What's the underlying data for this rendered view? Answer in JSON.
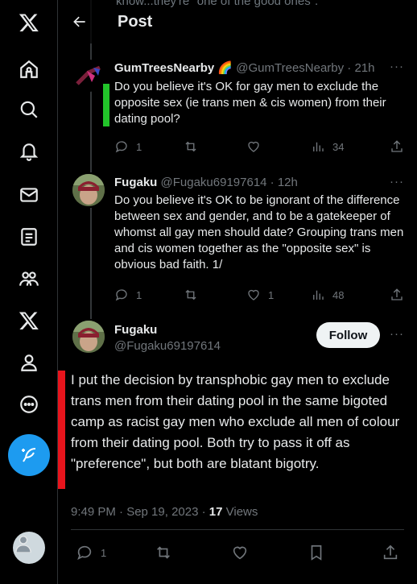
{
  "header": {
    "title": "Post",
    "ghost_text": "know...they're \"one of the good ones\"."
  },
  "nav": {
    "items": [
      "x-logo",
      "home",
      "explore",
      "notifications",
      "messages",
      "lists",
      "communities",
      "premium",
      "profile",
      "more"
    ],
    "post_button_icon": "compose-icon"
  },
  "tweets": [
    {
      "name": "GumTreesNearby",
      "handle": "@GumTreesNearby · 21h",
      "badge": "🌈",
      "text": "Do you believe it's OK for gay men to exclude the opposite sex (ie trans men & cis women) from their dating pool?",
      "replies": "1",
      "retweets": "",
      "likes": "",
      "views": "34"
    },
    {
      "name": "Fugaku",
      "handle": "@Fugaku69197614 · 12h",
      "text": "Do you believe it's OK to be ignorant of the difference between sex and gender, and to be a gatekeeper of whomst all gay men should date? Grouping trans men and cis women together as the \"opposite sex\" is obvious bad faith. 1/",
      "replies": "1",
      "retweets": "",
      "likes": "1",
      "views": "48"
    }
  ],
  "focus": {
    "name": "Fugaku",
    "handle": "@Fugaku69197614",
    "follow_label": "Follow",
    "text": "I put the decision by transphobic gay men to exclude trans men from their dating pool in the same bigoted camp as racist gay men who exclude all men of colour from their dating pool. Both try to pass it off as \"preference\", but both are blatant bigotry.",
    "time": "9:49 PM · Sep 19, 2023 · ",
    "views_count": "17",
    "views_label": " Views",
    "replies": "1"
  },
  "colors": {
    "accent_green": "#22c42a",
    "accent_red": "#e8141c",
    "brand_blue": "#1d9bf0"
  }
}
